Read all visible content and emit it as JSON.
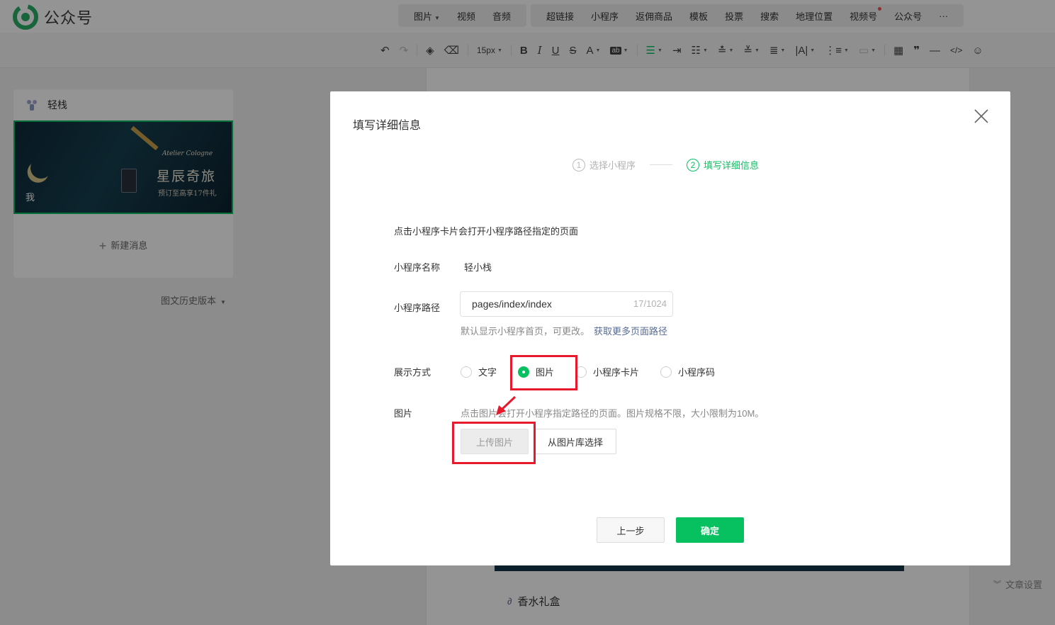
{
  "app": {
    "logo_text": "公众号"
  },
  "topmenu": {
    "group1": [
      {
        "label": "图片",
        "has_caret": true
      },
      {
        "label": "视频"
      },
      {
        "label": "音频"
      }
    ],
    "group2": [
      {
        "label": "超链接"
      },
      {
        "label": "小程序"
      },
      {
        "label": "返佣商品"
      },
      {
        "label": "模板"
      },
      {
        "label": "投票"
      },
      {
        "label": "搜索"
      },
      {
        "label": "地理位置"
      },
      {
        "label": "视频号",
        "has_dot": true
      },
      {
        "label": "公众号"
      },
      {
        "label": "···"
      }
    ]
  },
  "toolbar": {
    "font_size": "15px"
  },
  "left_panel": {
    "account_name": "轻栈",
    "cover": {
      "brand": "Atelier Cologne",
      "title": "星辰奇旅",
      "subtitle": "预订至高享17件礼",
      "me_label": "我"
    },
    "new_message": "新建消息",
    "history": "图文历史版本"
  },
  "background": {
    "link_text": "香水礼盒",
    "article_settings": "文章设置"
  },
  "dialog": {
    "title": "填写详细信息",
    "steps": [
      {
        "num": "1",
        "label": "选择小程序",
        "state": "inactive"
      },
      {
        "num": "2",
        "label": "填写详细信息",
        "state": "active"
      }
    ],
    "intro": "点击小程序卡片会打开小程序路径指定的页面",
    "miniprogram_name_label": "小程序名称",
    "miniprogram_name_value": "轻小栈",
    "path_label": "小程序路径",
    "path_value": "pages/index/index",
    "path_count": "17/1024",
    "path_hint": "默认显示小程序首页，可更改。",
    "path_hint_link": "获取更多页面路径",
    "display_label": "展示方式",
    "display_options": [
      {
        "label": "文字",
        "checked": false
      },
      {
        "label": "图片",
        "checked": true
      },
      {
        "label": "小程序卡片",
        "checked": false
      },
      {
        "label": "小程序码",
        "checked": false
      }
    ],
    "image_label": "图片",
    "image_desc": "点击图片会打开小程序指定路径的页面。图片规格不限，大小限制为10M。",
    "upload_button": "上传图片",
    "library_button": "从图片库选择",
    "prev_button": "上一步",
    "confirm_button": "确定"
  },
  "colors": {
    "brand_green": "#07c160",
    "highlight_red": "#e8192c",
    "link_blue": "#576b95"
  }
}
